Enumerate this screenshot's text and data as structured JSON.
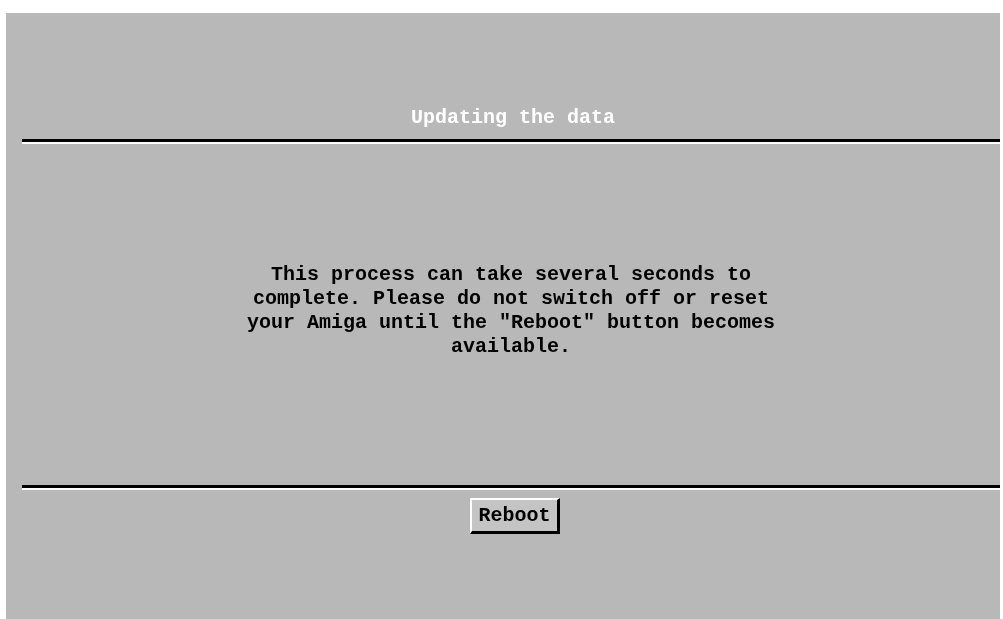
{
  "title": "Updating the data",
  "message": "This process can take several seconds to complete. Please do not switch off or reset your Amiga until the \"Reboot\" button becomes available.",
  "buttons": [
    {
      "label": "Reboot",
      "disabled": false
    }
  ]
}
